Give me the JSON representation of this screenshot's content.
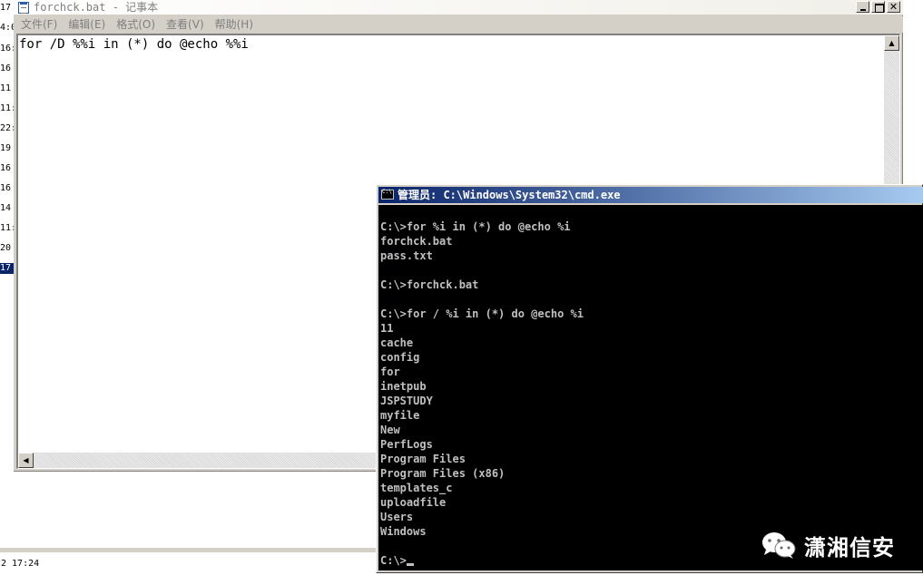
{
  "background": {
    "column_numbers": [
      "17",
      "4:0",
      "16:",
      "16",
      "11",
      "11:",
      "22:",
      "19",
      "16",
      "16",
      "14",
      "11:",
      "20",
      "17"
    ],
    "selected_index": 13,
    "status_text": "2 17:24"
  },
  "notepad": {
    "title": "forchck.bat - 记事本",
    "menu": [
      "文件(F)",
      "编辑(E)",
      "格式(O)",
      "查看(V)",
      "帮助(H)"
    ],
    "content": "for /D %%i in (*) do @echo %%i"
  },
  "cmd": {
    "title": "管理员: C:\\Windows\\System32\\cmd.exe",
    "lines": [
      "",
      "C:\\>for %i in (*) do @echo %i",
      "forchck.bat",
      "pass.txt",
      "",
      "C:\\>forchck.bat",
      "",
      "C:\\>for / %i in (*) do @echo %i",
      "11",
      "cache",
      "config",
      "for",
      "inetpub",
      "JSPSTUDY",
      "myfile",
      "New",
      "PerfLogs",
      "Program Files",
      "Program Files (x86)",
      "templates_c",
      "uploadfile",
      "Users",
      "Windows",
      ""
    ],
    "prompt": "C:\\>"
  },
  "watermark": {
    "text": "潇湘信安",
    "icon": "wechat-icon"
  },
  "colors": {
    "cmd_title_start": "#0a246a",
    "cmd_title_end": "#a6caf0",
    "console_bg": "#000000",
    "console_fg": "#c0c0c0",
    "chrome": "#d4d0c8"
  }
}
